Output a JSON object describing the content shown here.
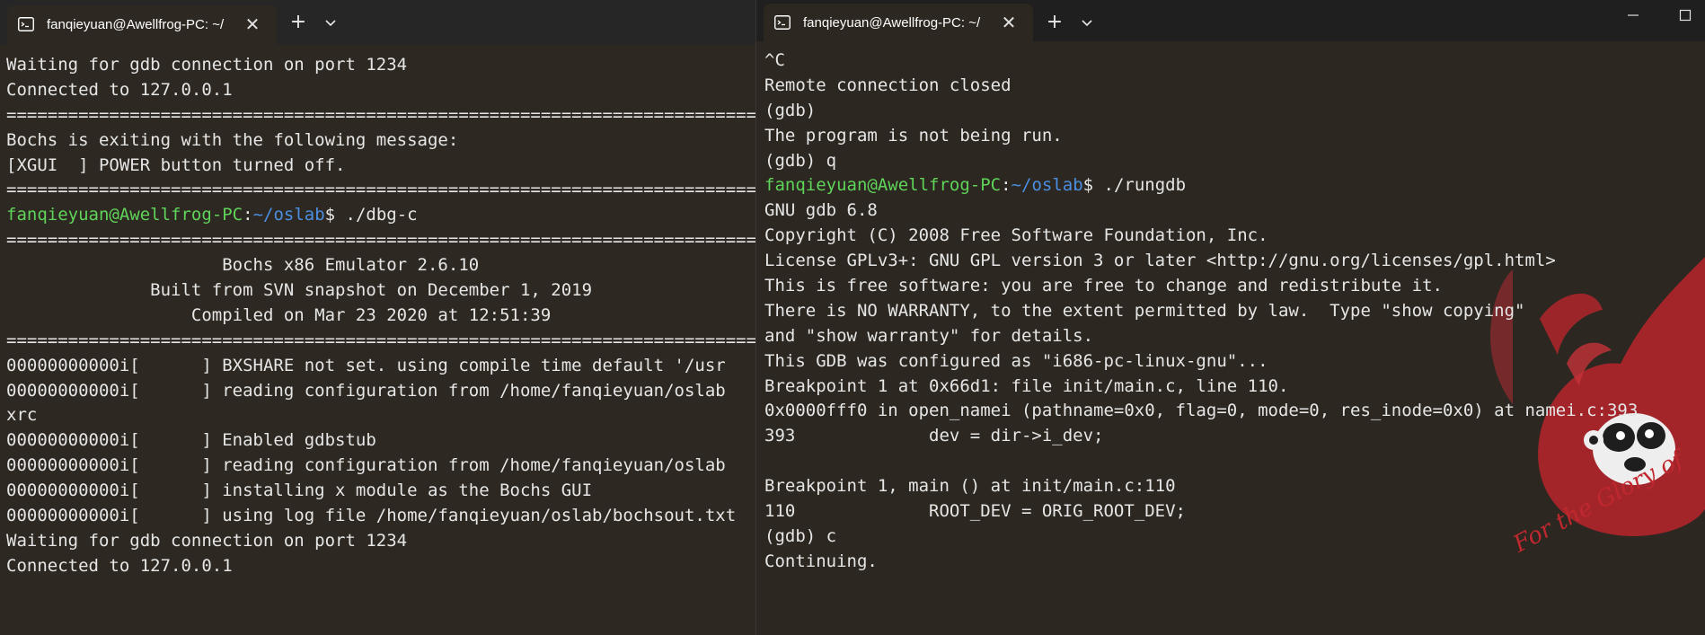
{
  "left_window": {
    "tab": {
      "title": "fanqieyuan@Awellfrog-PC: ~/",
      "close": "✕",
      "add": "+"
    },
    "lines": [
      {
        "text": "Waiting for gdb connection on port 1234"
      },
      {
        "text": "Connected to 127.0.0.1"
      },
      {
        "text": "=================================================================================================="
      },
      {
        "text": "Bochs is exiting with the following message:"
      },
      {
        "text": "[XGUI  ] POWER button turned off."
      },
      {
        "text": "=================================================================================================="
      },
      {
        "prompt_user": "fanqieyuan@Awellfrog-PC",
        "prompt_sep": ":",
        "prompt_path": "~/oslab",
        "prompt_dollar": "$",
        "command": " ./dbg-c"
      },
      {
        "text": "=================================================================================================="
      },
      {
        "text": "                     Bochs x86 Emulator 2.6.10"
      },
      {
        "text": "              Built from SVN snapshot on December 1, 2019"
      },
      {
        "text": "                  Compiled on Mar 23 2020 at 12:51:39"
      },
      {
        "text": "=================================================================================================="
      },
      {
        "text": "00000000000i[      ] BXSHARE not set. using compile time default '/usr"
      },
      {
        "text": "00000000000i[      ] reading configuration from /home/fanqieyuan/oslab"
      },
      {
        "text": "xrc"
      },
      {
        "text": "00000000000i[      ] Enabled gdbstub"
      },
      {
        "text": "00000000000i[      ] reading configuration from /home/fanqieyuan/oslab"
      },
      {
        "text": "00000000000i[      ] installing x module as the Bochs GUI"
      },
      {
        "text": "00000000000i[      ] using log file /home/fanqieyuan/oslab/bochsout.txt"
      },
      {
        "text": "Waiting for gdb connection on port 1234"
      },
      {
        "text": "Connected to 127.0.0.1"
      }
    ]
  },
  "right_window": {
    "tab": {
      "title": "fanqieyuan@Awellfrog-PC: ~/",
      "close": "✕",
      "add": "+"
    },
    "lines": [
      {
        "text": "^C"
      },
      {
        "text": "Remote connection closed"
      },
      {
        "text": "(gdb)"
      },
      {
        "text": "The program is not being run."
      },
      {
        "text": "(gdb) q"
      },
      {
        "prompt_user": "fanqieyuan@Awellfrog-PC",
        "prompt_sep": ":",
        "prompt_path": "~/oslab",
        "prompt_dollar": "$",
        "command": " ./rungdb"
      },
      {
        "text": "GNU gdb 6.8"
      },
      {
        "text": "Copyright (C) 2008 Free Software Foundation, Inc."
      },
      {
        "text": "License GPLv3+: GNU GPL version 3 or later <http://gnu.org/licenses/gpl.html>"
      },
      {
        "text": "This is free software: you are free to change and redistribute it."
      },
      {
        "text": "There is NO WARRANTY, to the extent permitted by law.  Type \"show copying\""
      },
      {
        "text": "and \"show warranty\" for details."
      },
      {
        "text": "This GDB was configured as \"i686-pc-linux-gnu\"..."
      },
      {
        "text": "Breakpoint 1 at 0x66d1: file init/main.c, line 110."
      },
      {
        "text": "0x0000fff0 in open_namei (pathname=0x0, flag=0, mode=0, res_inode=0x0) at namei.c:393"
      },
      {
        "text": "393             dev = dir->i_dev;"
      },
      {
        "text": ""
      },
      {
        "text": "Breakpoint 1, main () at init/main.c:110"
      },
      {
        "text": "110             ROOT_DEV = ORIG_ROOT_DEV;"
      },
      {
        "text": "(gdb) c"
      },
      {
        "text": "Continuing."
      }
    ],
    "watermark_text": "For the Glory of"
  },
  "colors": {
    "terminal_bg": "#2d2821",
    "text": "#e6e6e6",
    "prompt_user": "#5fd35a",
    "prompt_path": "#4a8ee0",
    "watermark": "#c0282f"
  }
}
